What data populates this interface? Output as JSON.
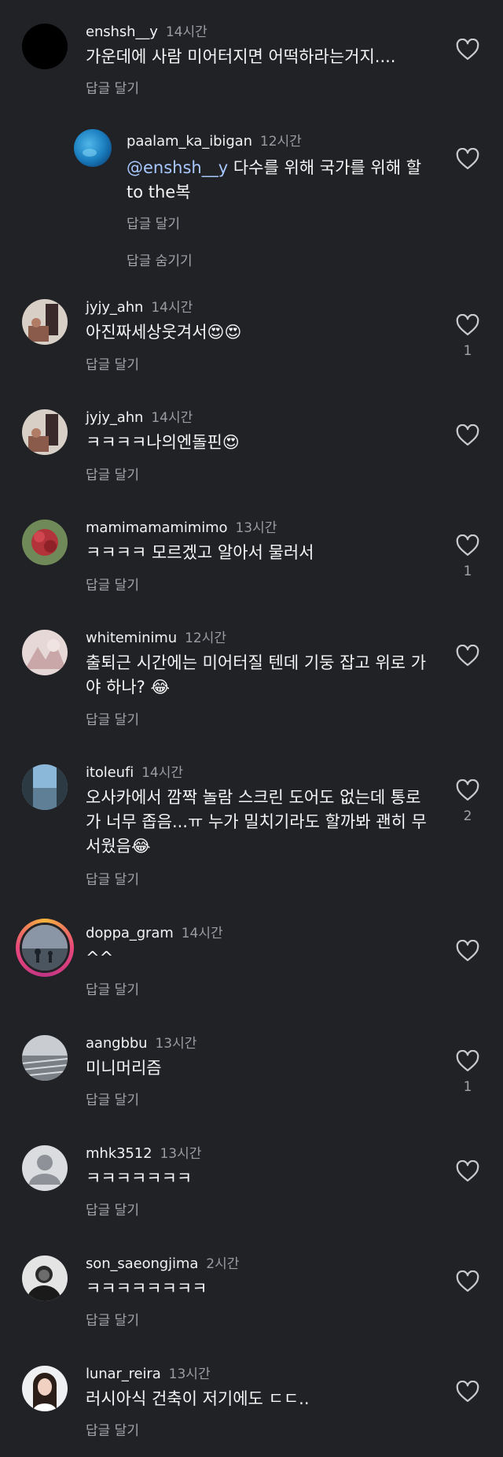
{
  "reply_action_label": "답글 달기",
  "hide_replies_label": "답글 숨기기",
  "comments": [
    {
      "username": "enshsh__y",
      "time": "14시간",
      "text": "가운데에 사람 미어터지면  어떡하라는거지....",
      "likes": ""
    },
    {
      "username": "paalam_ka_ibigan",
      "time": "12시간",
      "mention": "@enshsh__y",
      "text": " 다수를 위해 국가를 위해 할to the복",
      "likes": ""
    },
    {
      "username": "jyjy_ahn",
      "time": "14시간",
      "text": "아진짜세상웃겨서😍😍",
      "likes": "1"
    },
    {
      "username": "jyjy_ahn",
      "time": "14시간",
      "text": "ㅋㅋㅋㅋ나의엔돌핀😍",
      "likes": ""
    },
    {
      "username": "mamimamamimimo",
      "time": "13시간",
      "text": "ㅋㅋㅋㅋ 모르겠고 알아서 물러서",
      "likes": "1"
    },
    {
      "username": "whiteminimu",
      "time": "12시간",
      "text": "출퇴근 시간에는 미어터질 텐데 기둥 잡고 위로 가야 하나? 😂",
      "likes": ""
    },
    {
      "username": "itoleufi",
      "time": "14시간",
      "text": "오사카에서 깜짝 놀람 스크린 도어도 없는데 통로가 너무 좁음...ㅠ 누가 밀치기라도 할까봐 괜히 무서웠음😂",
      "likes": "2"
    },
    {
      "username": "doppa_gram",
      "time": "14시간",
      "text": "^^",
      "likes": ""
    },
    {
      "username": "aangbbu",
      "time": "13시간",
      "text": "미니머리즘",
      "likes": "1"
    },
    {
      "username": "mhk3512",
      "time": "13시간",
      "text": "ㅋㅋㅋㅋㅋㅋㅋ",
      "likes": ""
    },
    {
      "username": "son_saeongjima",
      "time": "2시간",
      "text": "ㅋㅋㅋㅋㅋㅋㅋㅋ",
      "likes": ""
    },
    {
      "username": "lunar_reira",
      "time": "13시간",
      "text": "러시아식 건축이 저기에도 ㄷㄷ..",
      "likes": ""
    }
  ]
}
